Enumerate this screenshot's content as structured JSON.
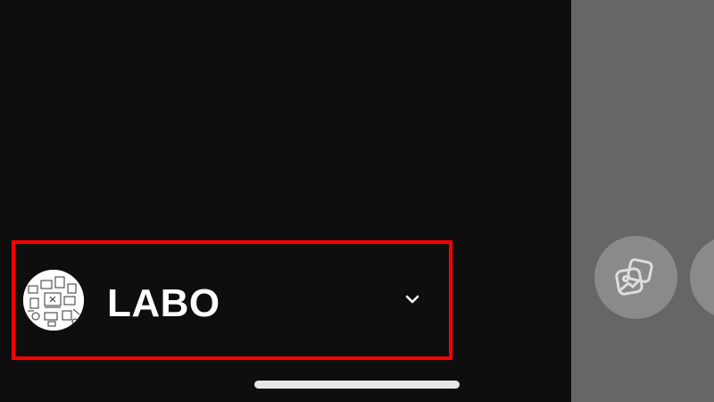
{
  "account": {
    "name": "LABO",
    "avatar_icon": "avatar-doodle-icon",
    "dropdown_icon": "chevron-down-icon"
  },
  "right_panel": {
    "buttons": [
      {
        "icon": "gallery-icon"
      },
      {
        "icon": "unknown-icon"
      }
    ]
  },
  "colors": {
    "background": "#0e0e0e",
    "right_panel": "#666666",
    "highlight": "#ff0000",
    "button": "#8a8a8a",
    "text": "#ffffff"
  }
}
